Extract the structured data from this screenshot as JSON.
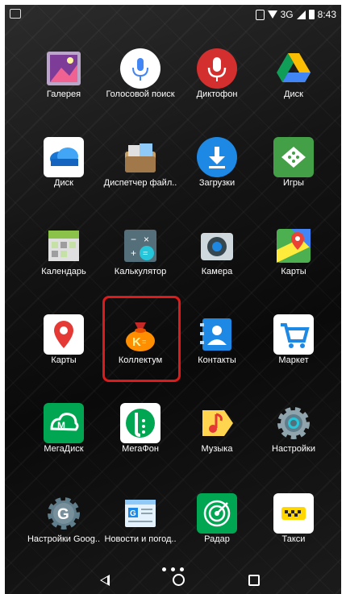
{
  "status_bar": {
    "network": "3G",
    "time": "8:43"
  },
  "apps": [
    {
      "label": "Галерея",
      "icon": "gallery-icon"
    },
    {
      "label": "Голосовой поиск",
      "icon": "microphone-icon"
    },
    {
      "label": "Диктофон",
      "icon": "recorder-icon"
    },
    {
      "label": "Диск",
      "icon": "google-drive-icon"
    },
    {
      "label": "Диск",
      "icon": "cloud-disk-icon"
    },
    {
      "label": "Диспетчер файл..",
      "icon": "file-manager-icon"
    },
    {
      "label": "Загрузки",
      "icon": "download-icon"
    },
    {
      "label": "Игры",
      "icon": "games-icon"
    },
    {
      "label": "Календарь",
      "icon": "calendar-icon"
    },
    {
      "label": "Калькулятор",
      "icon": "calculator-icon"
    },
    {
      "label": "Камера",
      "icon": "camera-icon"
    },
    {
      "label": "Карты",
      "icon": "google-maps-icon"
    },
    {
      "label": "Карты",
      "icon": "yandex-maps-icon"
    },
    {
      "label": "Коллектум",
      "icon": "money-bag-icon"
    },
    {
      "label": "Контакты",
      "icon": "contacts-icon"
    },
    {
      "label": "Маркет",
      "icon": "market-cart-icon"
    },
    {
      "label": "МегаДиск",
      "icon": "megadisk-icon"
    },
    {
      "label": "МегаФон",
      "icon": "megafon-icon"
    },
    {
      "label": "Музыка",
      "icon": "music-icon"
    },
    {
      "label": "Настройки",
      "icon": "settings-gear-icon"
    },
    {
      "label": "Настройки Goog..",
      "icon": "google-settings-icon"
    },
    {
      "label": "Новости и погод..",
      "icon": "news-weather-icon"
    },
    {
      "label": "Радар",
      "icon": "radar-icon"
    },
    {
      "label": "Такси",
      "icon": "taxi-icon"
    }
  ],
  "highlighted_app": "Коллектум",
  "page_indicator": {
    "pages": 3
  },
  "colors": {
    "highlight": "#e01a1a"
  }
}
